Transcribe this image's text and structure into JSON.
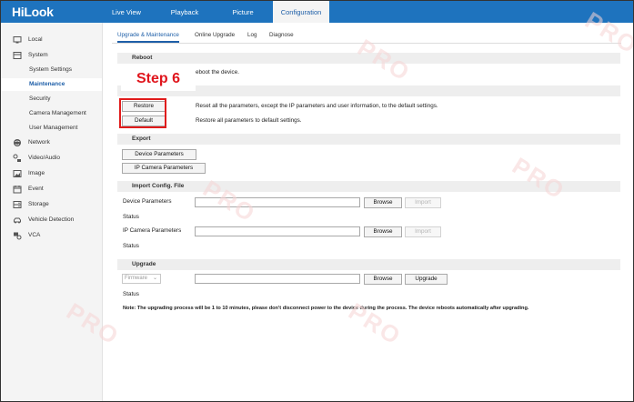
{
  "app": {
    "logo": "HiLook"
  },
  "nav": {
    "tabs": [
      {
        "label": "Live View"
      },
      {
        "label": "Playback"
      },
      {
        "label": "Picture"
      },
      {
        "label": "Configuration"
      }
    ]
  },
  "sidebar": {
    "items": [
      {
        "label": "Local",
        "icon": "monitor-icon"
      },
      {
        "label": "System",
        "icon": "system-icon"
      },
      {
        "label": "System Settings"
      },
      {
        "label": "Maintenance"
      },
      {
        "label": "Security"
      },
      {
        "label": "Camera Management"
      },
      {
        "label": "User Management"
      },
      {
        "label": "Network",
        "icon": "globe-icon"
      },
      {
        "label": "Video/Audio",
        "icon": "video-audio-icon"
      },
      {
        "label": "Image",
        "icon": "image-icon"
      },
      {
        "label": "Event",
        "icon": "calendar-icon"
      },
      {
        "label": "Storage",
        "icon": "storage-icon"
      },
      {
        "label": "Vehicle Detection",
        "icon": "car-icon"
      },
      {
        "label": "VCA",
        "icon": "vca-icon"
      }
    ]
  },
  "subtabs": [
    {
      "label": "Upgrade & Maintenance"
    },
    {
      "label": "Online Upgrade"
    },
    {
      "label": "Log"
    },
    {
      "label": "Diagnose"
    }
  ],
  "reboot": {
    "title": "Reboot",
    "desc": "eboot the device."
  },
  "defaults": {
    "restore_label": "Restore",
    "restore_desc": "Reset all the parameters, except the IP parameters and user information, to the default settings.",
    "default_label": "Default",
    "default_desc": "Restore all parameters to default settings."
  },
  "export": {
    "title": "Export",
    "device_params": "Device Parameters",
    "ip_camera_params": "IP Camera Parameters"
  },
  "import": {
    "title": "Import Config. File",
    "device_params_label": "Device Parameters",
    "ip_camera_params_label": "IP Camera Parameters",
    "status_label": "Status",
    "browse_label": "Browse",
    "import_label": "Import"
  },
  "upgrade": {
    "title": "Upgrade",
    "select_value": "Firmware",
    "browse_label": "Browse",
    "upgrade_label": "Upgrade",
    "status_label": "Status",
    "note": "Note: The upgrading process will be 1 to 10 minutes, please don't disconnect power to the device during the process. The device reboots automatically after upgrading."
  },
  "annotation": {
    "step_label": "Step 6",
    "color": "#e0161d"
  },
  "colors": {
    "brand": "#1e73be",
    "accent": "#1e5fa8"
  }
}
